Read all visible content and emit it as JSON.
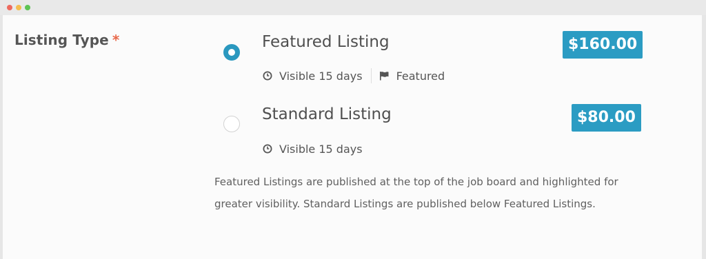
{
  "window": {
    "controls": {
      "close_color": "#ee6a5e",
      "minimize_color": "#f5bd4f",
      "zoom_color": "#5ec454"
    }
  },
  "field": {
    "label": "Listing Type",
    "required_marker": "*",
    "required_color": "#e8684a"
  },
  "options": [
    {
      "title": "Featured Listing",
      "price": "$160.00",
      "selected": true,
      "meta": [
        {
          "icon": "clock-icon",
          "text": "Visible 15 days"
        },
        {
          "icon": "flag-icon",
          "text": "Featured"
        }
      ]
    },
    {
      "title": "Standard Listing",
      "price": "$80.00",
      "selected": false,
      "meta": [
        {
          "icon": "clock-icon",
          "text": "Visible 15 days"
        }
      ]
    }
  ],
  "description": "Featured Listings are published at the top of the job board and highlighted for greater visibility. Standard Listings are published below Featured Listings.",
  "colors": {
    "accent": "#2a98bf",
    "badge_bg": "#2b9cc3",
    "text": "#555555"
  }
}
